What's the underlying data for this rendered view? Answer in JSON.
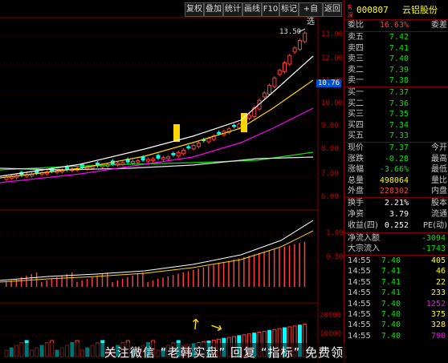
{
  "toolbar": {
    "buttons": [
      "复权",
      "叠加",
      "统计",
      "画线",
      "F10",
      "标记",
      "+自选",
      "返回"
    ]
  },
  "price_axis": [
    "13.00",
    "12.00",
    "11.00",
    "10.00",
    "9.00",
    "8.00",
    "7.00",
    "6.00"
  ],
  "current_price_tag": "10.76",
  "high_label": "13.50",
  "indicator_axis": [
    "1.00",
    "0.50"
  ],
  "volume_axis": [
    "20000",
    "10000"
  ],
  "header": {
    "code_prefix": "R",
    "code_sub": "深",
    "code": "000807",
    "name": "云铝股份"
  },
  "ratio": {
    "label": "委比",
    "value": "16.63%",
    "label2": "委差"
  },
  "asks": [
    {
      "label": "卖五",
      "price": "7.42"
    },
    {
      "label": "卖四",
      "price": "7.41"
    },
    {
      "label": "卖三",
      "price": "7.40"
    },
    {
      "label": "卖二",
      "price": "7.39"
    },
    {
      "label": "卖一",
      "price": "7.38"
    }
  ],
  "bids": [
    {
      "label": "买一",
      "price": "7.37"
    },
    {
      "label": "买二",
      "price": "7.36"
    },
    {
      "label": "买三",
      "price": "7.35"
    },
    {
      "label": "买四",
      "price": "7.34"
    },
    {
      "label": "买五",
      "price": "7.33"
    }
  ],
  "quote": [
    {
      "label": "现价",
      "value": "7.37",
      "label2": "今开",
      "color": "green"
    },
    {
      "label": "涨跌",
      "value": "-0.28",
      "label2": "最高",
      "color": "green"
    },
    {
      "label": "涨幅",
      "value": "-3.66%",
      "label2": "最低",
      "color": "green"
    },
    {
      "label": "总量",
      "value": "498064",
      "label2": "量比",
      "color": "yellow"
    },
    {
      "label": "外盘",
      "value": "228302",
      "label2": "内盘",
      "color": "red"
    }
  ],
  "stats": [
    {
      "label": "换手",
      "value": "2.21%",
      "label2": "股本"
    },
    {
      "label": "净资",
      "value": "3.79",
      "label2": "流通"
    },
    {
      "label": "收益(四)",
      "value": "0.252",
      "label2": "PE(动)"
    }
  ],
  "flows": [
    {
      "label": "净流入额",
      "value": "-3094"
    },
    {
      "label": "大宗流入",
      "value": "-1743"
    }
  ],
  "ticks": [
    {
      "time": "14:55",
      "price": "7.40",
      "vol": "405",
      "color": "yellow"
    },
    {
      "time": "14:55",
      "price": "7.41",
      "vol": "46",
      "color": "yellow"
    },
    {
      "time": "14:55",
      "price": "7.41",
      "vol": "22",
      "color": "yellow"
    },
    {
      "time": "14:55",
      "price": "7.41",
      "vol": "233",
      "color": "yellow"
    },
    {
      "time": "14:55",
      "price": "7.40",
      "vol": "1252",
      "color": "purple"
    },
    {
      "time": "14:55",
      "price": "7.40",
      "vol": "375",
      "color": "yellow"
    },
    {
      "time": "14:55",
      "price": "7.40",
      "vol": "328",
      "color": "yellow"
    },
    {
      "time": "14:55",
      "price": "7.40",
      "vol": "790",
      "color": "purple"
    }
  ],
  "watermark": "关注微信 “老韩实盘” 回复 “指标” 免费领"
}
